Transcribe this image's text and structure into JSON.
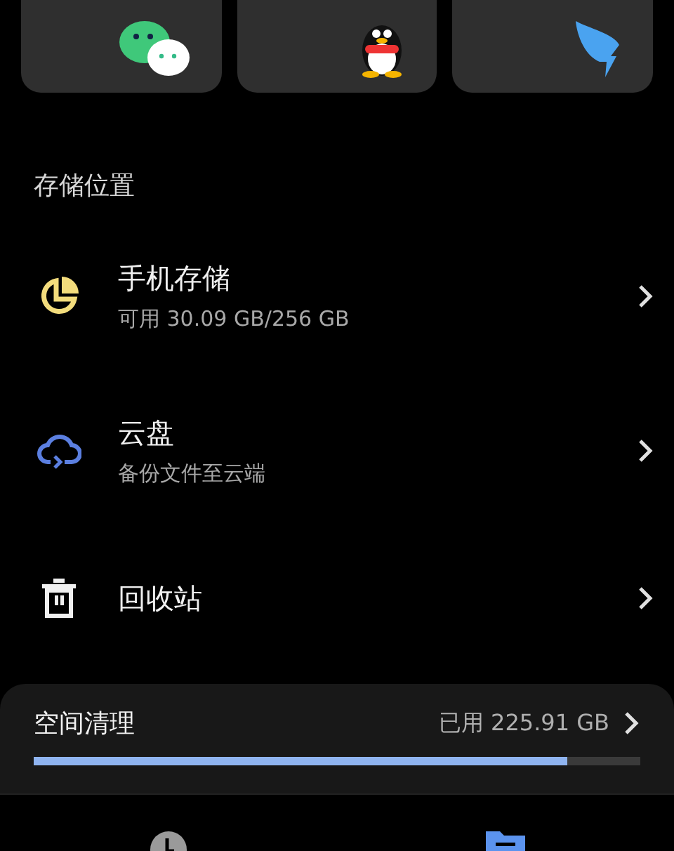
{
  "app_cards": [
    {
      "kind": "chat"
    },
    {
      "kind": "penguin"
    },
    {
      "kind": "wing"
    }
  ],
  "section_title": "存储位置",
  "locations": [
    {
      "kind": "pie",
      "title": "手机存储",
      "subtitle": "可用 30.09 GB/256 GB"
    },
    {
      "kind": "cloud",
      "title": "云盘",
      "subtitle": "备份文件至云端"
    },
    {
      "kind": "trash",
      "title": "回收站"
    }
  ],
  "cleanup": {
    "title": "空间清理",
    "usage": "已用 225.91 GB",
    "level": 0.88
  },
  "bottom_nav": [
    {
      "kind": "recent",
      "selected": false
    },
    {
      "kind": "files",
      "selected": true
    }
  ]
}
